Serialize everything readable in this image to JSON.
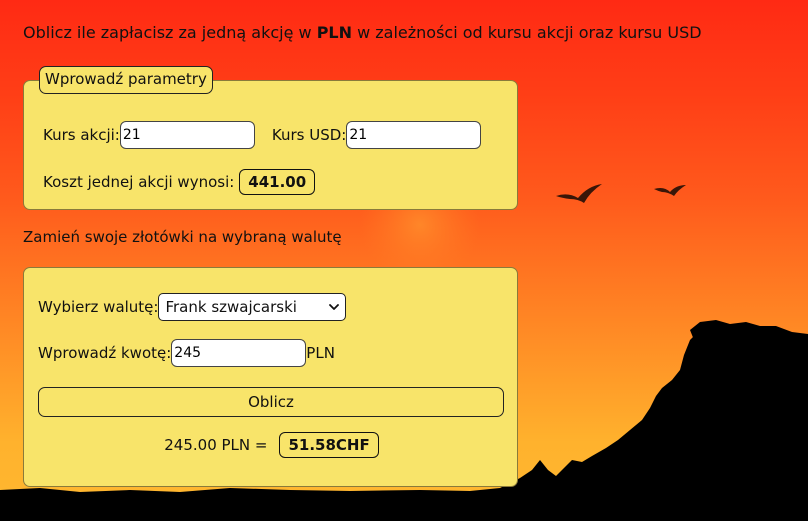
{
  "headline": {
    "part1": "Oblicz ile zapłacisz za jedną akcję w ",
    "bold": "PLN",
    "part2": " w zależności od kursu akcji oraz kursu USD"
  },
  "params_panel": {
    "legend": "Wprowadź parametry",
    "stock_price_label": "Kurs akcji:",
    "stock_price_value": "21",
    "usd_rate_label": "Kurs USD:",
    "usd_rate_value": "21",
    "cost_label": "Koszt jednej akcji wynosi:",
    "cost_value": "441.00"
  },
  "currency_section": {
    "heading": "Zamień swoje złotówki na wybraną walutę",
    "currency_label": "Wybierz walutę:",
    "currency_selected": "Frank szwajcarski",
    "amount_label": "Wprowadź kwotę:",
    "amount_value": "245",
    "amount_unit": "PLN",
    "calculate_button": "Oblicz",
    "conversion_source": "245.00 PLN =",
    "conversion_result": "51.58CHF"
  },
  "colors": {
    "panel_bg": "#f8e46a",
    "sky_top": "#ff2a14",
    "sky_bottom": "#ffb830",
    "silhouette": "#000000"
  }
}
